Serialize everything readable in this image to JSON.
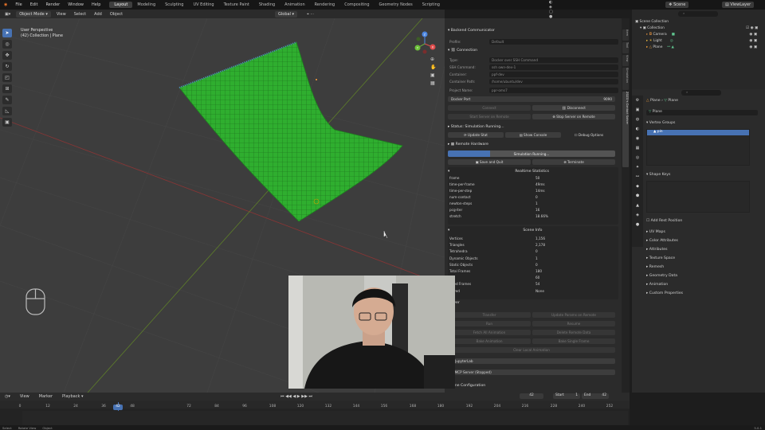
{
  "topbar": {
    "menus": [
      "File",
      "Edit",
      "Render",
      "Window",
      "Help"
    ],
    "workspaces": [
      "Layout",
      "Modeling",
      "Sculpting",
      "UV Editing",
      "Texture Paint",
      "Shading",
      "Animation",
      "Rendering",
      "Compositing",
      "Geometry Nodes",
      "Scripting"
    ],
    "active_workspace": "Layout",
    "scene": "Scene",
    "view_layer": "ViewLayer"
  },
  "viewport": {
    "mode": "Object Mode",
    "menus": [
      "View",
      "Select",
      "Add",
      "Object"
    ],
    "transform": "Global",
    "options_label": "Options",
    "overlay_title": "User Perspective",
    "overlay_sub": "(42) Collection | Plane",
    "gizmo_x": "X",
    "gizmo_y": "Y",
    "gizmo_z": "Z"
  },
  "backend": {
    "title": "Backend Communicator",
    "profile_label": "Profile:",
    "profile_value": "Default",
    "connection_label": "Connection",
    "fields": [
      {
        "k": "Type:",
        "v": "Docker over SSH Command"
      },
      {
        "k": "SSH Command:",
        "v": "ssh own-dev-1"
      },
      {
        "k": "Container:",
        "v": "ppf-dev"
      },
      {
        "k": "Container Path:",
        "v": "/home/ubuntu/dev"
      },
      {
        "k": "Project Name:",
        "v": "ppr-oms7"
      }
    ],
    "docker_port_label": "Docker Port",
    "docker_port_value": "9090",
    "connect": "Connect",
    "disconnect": "Disconnect",
    "start_server": "Start Server on Remote",
    "stop_server": "Stop Server on Remote",
    "status": "Status: Simulation Running...",
    "update_stat": "Update Stat",
    "show_console": "Show Console",
    "debug_options": "Debug Options",
    "remote_hardware": "Remote Hardware",
    "sim_progress_label": "Simulation Running...",
    "sim_progress": 0.25,
    "save_quit": "Save and Quit",
    "terminate": "Terminate",
    "realtime_title": "Realtime Statistics",
    "realtime": [
      {
        "k": "frame",
        "v": "50"
      },
      {
        "k": "time-per-frame",
        "v": "49ms"
      },
      {
        "k": "time-per-step",
        "v": "14ms"
      },
      {
        "k": "num-contact",
        "v": "0"
      },
      {
        "k": "newton-steps",
        "v": "1"
      },
      {
        "k": "pcg-iter",
        "v": "16"
      },
      {
        "k": "stretch",
        "v": "18.66%"
      }
    ],
    "scene_title": "Scene Info",
    "scene_info": [
      {
        "k": "Vertices",
        "v": "1,156"
      },
      {
        "k": "Triangles",
        "v": "2,178"
      },
      {
        "k": "Tetrahedra",
        "v": "0"
      },
      {
        "k": "Dynamic Objects",
        "v": "1"
      },
      {
        "k": "Static Objects",
        "v": "0"
      },
      {
        "k": "Total Frames",
        "v": "180"
      },
      {
        "k": "",
        "v": "60"
      },
      {
        "k": "lated Frames",
        "v": "54"
      },
      {
        "k": "Saved",
        "v": "None"
      }
    ],
    "solver_label": "lver",
    "transfer": "Transfer",
    "update_params": "Update Params on Remote",
    "run": "Run",
    "resume": "Resume",
    "fetch_anim": "Fetch All Animation",
    "delete_data": "Delete Remote Data",
    "bake_anim": "Bake Animation",
    "bake_single": "Bake Single Frame",
    "clear_anim": "Clear Local Animation",
    "jupyter": "JupyterLab",
    "mcp": "MCP Server (Stopped)",
    "scene_config": "ene Configuration"
  },
  "vtabs": [
    "Item",
    "Tool",
    "View",
    "Simulation",
    "ZOZO's Contact Solver"
  ],
  "outliner": {
    "search_placeholder": "",
    "root": "Scene Collection",
    "collection": "Collection",
    "items": [
      "Camera",
      "Light",
      "Plane"
    ]
  },
  "properties": {
    "obj_crumb_a": "Plane",
    "obj_crumb_b": "Plane",
    "obj_name": "Plane",
    "vertex_groups": "Vertex Groups",
    "vg_item": "pin",
    "shape_keys": "Shape Keys",
    "rest_position": "Add Rest Position",
    "sections": [
      "UV Maps",
      "Color Attributes",
      "Attributes",
      "Texture Space",
      "Remesh",
      "Geometry Data",
      "Animation",
      "Custom Properties"
    ]
  },
  "timeline": {
    "menus": [
      "View",
      "Marker",
      "Playback"
    ],
    "current_frame": "42",
    "start_label": "Start",
    "start": "1",
    "end_label": "End",
    "end": "42",
    "ticks": [
      "0",
      "12",
      "24",
      "36",
      "42",
      "48",
      "72",
      "84",
      "96",
      "108",
      "120",
      "132",
      "144",
      "156",
      "168",
      "180",
      "192",
      "204",
      "216",
      "228",
      "240",
      "252"
    ]
  },
  "statusbar": {
    "items": [
      "Select",
      "Rotate View",
      "Object"
    ],
    "version": "5.0.1"
  },
  "colors": {
    "accent": "#4772b3",
    "cloth": "#2fae2f",
    "progress": "#4772b3"
  }
}
